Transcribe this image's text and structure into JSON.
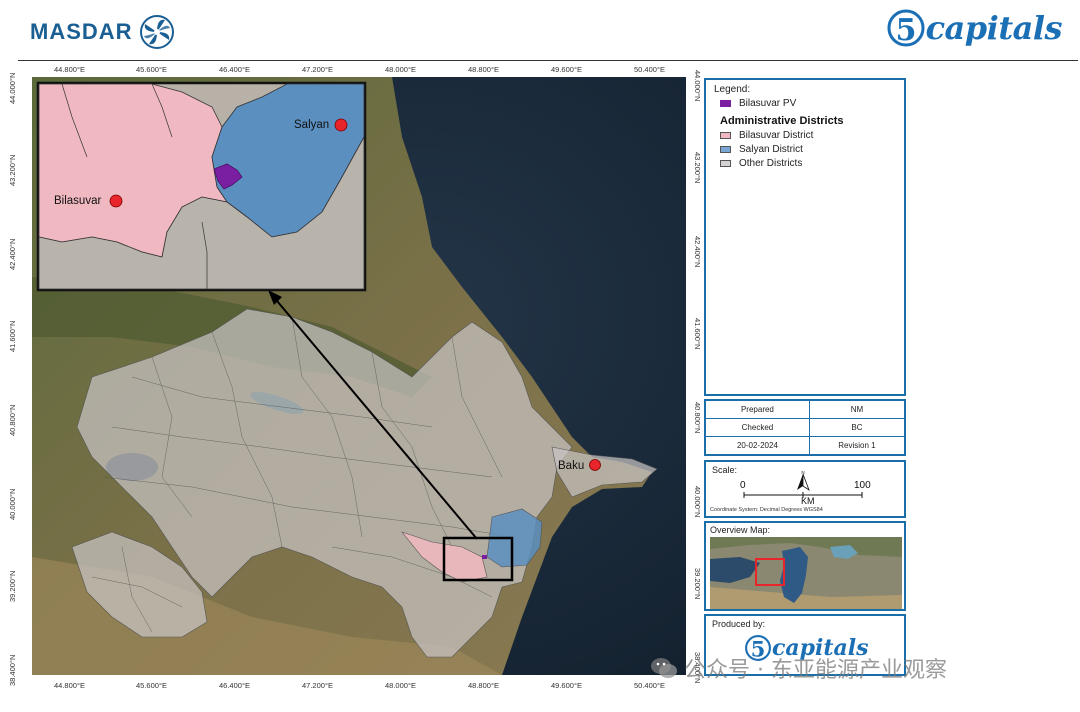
{
  "header": {
    "left_logo_text": "MASDAR",
    "right_logo_text": "capitals",
    "right_logo_digit": "5"
  },
  "map": {
    "city_labels": [
      "Salyan",
      "Bilasuvar",
      "Baku"
    ],
    "top_ticks": [
      "44.800°E",
      "45.600°E",
      "46.400°E",
      "47.200°E",
      "48.000°E",
      "48.800°E",
      "49.600°E",
      "50.400°E"
    ],
    "bottom_ticks": [
      "44.800°E",
      "45.600°E",
      "46.400°E",
      "47.200°E",
      "48.000°E",
      "48.800°E",
      "49.600°E",
      "50.400°E"
    ],
    "left_ticks": [
      "44.000°N",
      "43.200°N",
      "42.400°N",
      "41.600°N",
      "40.800°N",
      "40.000°N",
      "39.200°N",
      "38.400°N"
    ],
    "right_ticks": [
      "44.000°N",
      "43.200°N",
      "42.400°N",
      "41.600°N",
      "40.800°N",
      "40.000°N",
      "39.200°N",
      "38.400°N"
    ],
    "colors": {
      "bilasuvar_pv": "#7b1fa2",
      "bilasuvar_district": "#f0b8c0",
      "salyan_district": "#5b8fc0",
      "other_districts": "#c8c4c4",
      "city_marker": "#e8252b"
    }
  },
  "legend": {
    "title": "Legend:",
    "pv_label": "Bilasuvar PV",
    "districts_heading": "Administrative Districts",
    "items": [
      "Bilasuvar District",
      "Salyan District",
      "Other Districts"
    ]
  },
  "info": {
    "prepared_label": "Prepared",
    "prepared_value": "NM",
    "checked_label": "Checked",
    "checked_value": "BC",
    "date": "20-02-2024",
    "revision": "Revision 1"
  },
  "scale": {
    "title": "Scale:",
    "start": "0",
    "end": "100",
    "unit": "KM",
    "north": "N",
    "coord_system": "Coordinate System: Decimal Degrees WGS84"
  },
  "overview": {
    "title": "Overview Map:"
  },
  "produced": {
    "title": "Produced by:",
    "logo_text": "capitals",
    "logo_digit": "5"
  },
  "watermark": {
    "text": "公众号 · 东亚能源产业观察"
  }
}
